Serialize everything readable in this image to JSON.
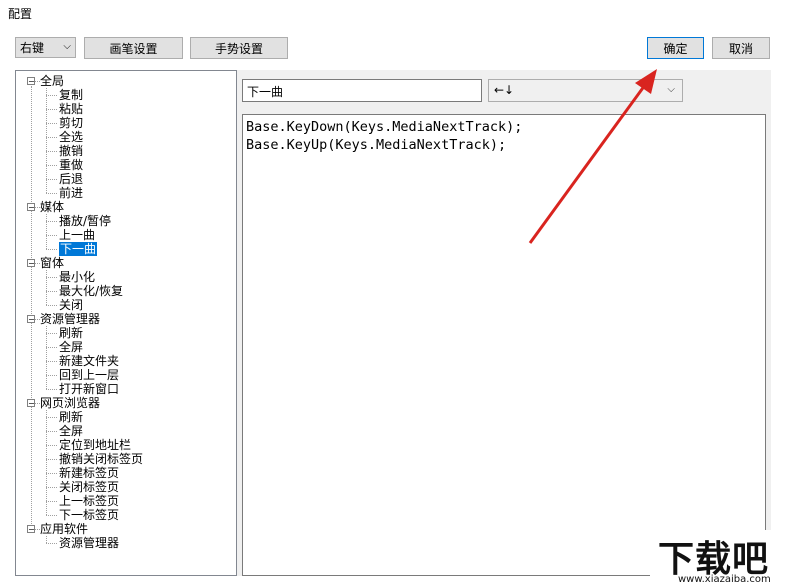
{
  "window": {
    "title": "配置"
  },
  "toolbar": {
    "mouse_button": "右键",
    "pen_settings": "画笔设置",
    "gesture_settings": "手势设置",
    "ok": "确定",
    "cancel": "取消"
  },
  "tree": [
    {
      "label": "全局",
      "children": [
        "复制",
        "粘贴",
        "剪切",
        "全选",
        "撤销",
        "重做",
        "后退",
        "前进"
      ]
    },
    {
      "label": "媒体",
      "children": [
        "播放/暂停",
        "上一曲",
        "下一曲"
      ]
    },
    {
      "label": "窗体",
      "children": [
        "最小化",
        "最大化/恢复",
        "关闭"
      ]
    },
    {
      "label": "资源管理器",
      "children": [
        "刷新",
        "全屏",
        "新建文件夹",
        "回到上一层",
        "打开新窗口"
      ]
    },
    {
      "label": "网页浏览器",
      "children": [
        "刷新",
        "全屏",
        "定位到地址栏",
        "撤销关闭标签页",
        "新建标签页",
        "关闭标签页",
        "上一标签页",
        "下一标签页"
      ]
    },
    {
      "label": "应用软件",
      "children": [
        "资源管理器"
      ]
    }
  ],
  "selected": "下一曲",
  "action": {
    "name": "下一曲",
    "key_combo": "←↓",
    "script": "Base.KeyDown(Keys.MediaNextTrack);\nBase.KeyUp(Keys.MediaNextTrack);"
  },
  "watermark": {
    "main": "下载吧",
    "sub": "www.xiazaiba.com"
  },
  "colors": {
    "selection": "#0078d7",
    "arrow": "#d9241f",
    "panel": "#f0f0f0"
  }
}
